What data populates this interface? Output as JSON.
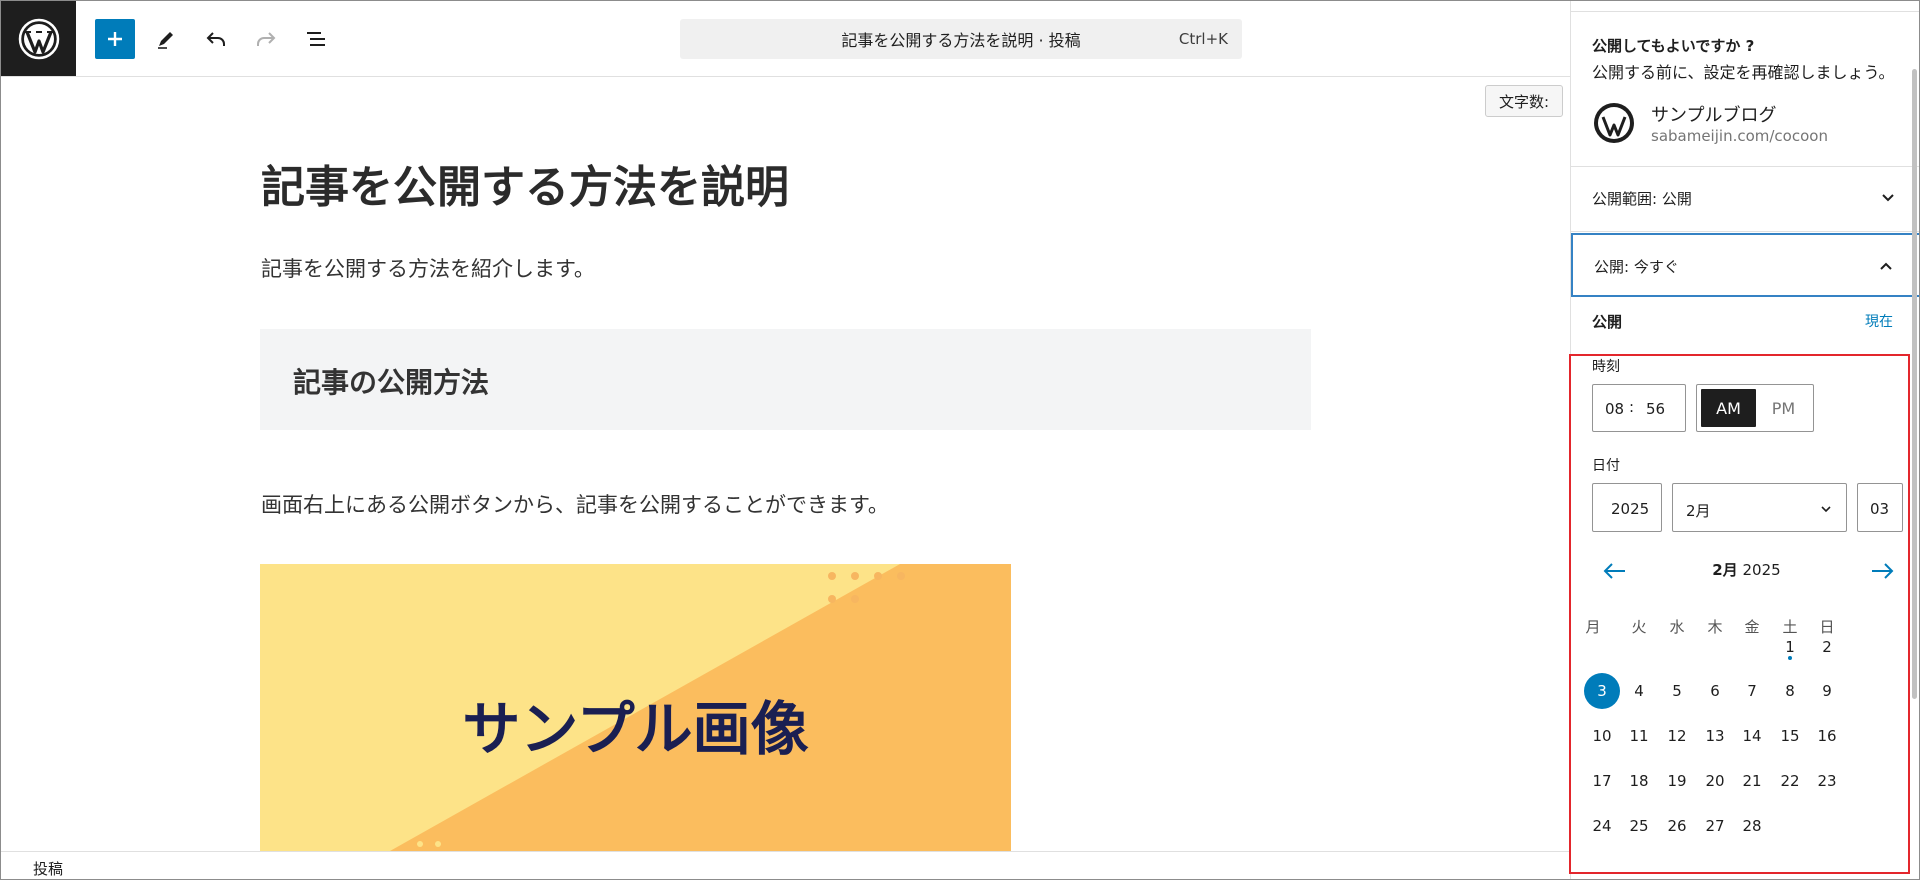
{
  "editor": {
    "document_bar": "記事を公開する方法を説明 · 投稿",
    "document_shortcut": "Ctrl+K",
    "word_count_label": "文字数:",
    "post_title": "記事を公開する方法を説明",
    "paragraph1": "記事を公開する方法を紹介します。",
    "heading2": "記事の公開方法",
    "paragraph2": "画面右上にある公開ボタンから、記事を公開することができます。",
    "image_text": "サンプル画像",
    "image_colors": {
      "light": "#fde388",
      "dark": "#fbbd5e",
      "text": "#1a1f52"
    }
  },
  "footer": {
    "breadcrumb": "投稿"
  },
  "sidebar": {
    "question": "公開してもよいですか ?",
    "subtitle": "公開する前に、設定を再確認しましょう。",
    "site_name": "サンプルブログ",
    "site_url": "sabameijin.com/cocoon",
    "visibility_row": "公開範囲: 公開",
    "publish_row": "公開: 今すぐ",
    "publish_label": "公開",
    "now_link": "現在",
    "time_label": "時刻",
    "hour": "08",
    "minute": "56",
    "am": "AM",
    "pm": "PM",
    "date_label": "日付",
    "year": "2025",
    "month": "2月",
    "day": "03",
    "calendar": {
      "month_label": "2月",
      "year_label": "2025",
      "weekdays": [
        "月",
        "火",
        "水",
        "木",
        "金",
        "土",
        "日"
      ],
      "weeks": [
        [
          "",
          "",
          "",
          "",
          "",
          "1",
          "2"
        ],
        [
          "3",
          "4",
          "5",
          "6",
          "7",
          "8",
          "9"
        ],
        [
          "10",
          "11",
          "12",
          "13",
          "14",
          "15",
          "16"
        ],
        [
          "17",
          "18",
          "19",
          "20",
          "21",
          "22",
          "23"
        ],
        [
          "24",
          "25",
          "26",
          "27",
          "28",
          "",
          ""
        ]
      ],
      "selected_day": "3",
      "today_day": "1"
    }
  },
  "colors": {
    "accent": "#007cba",
    "highlight_box": "#e3262c",
    "dark": "#1e1e1e"
  }
}
